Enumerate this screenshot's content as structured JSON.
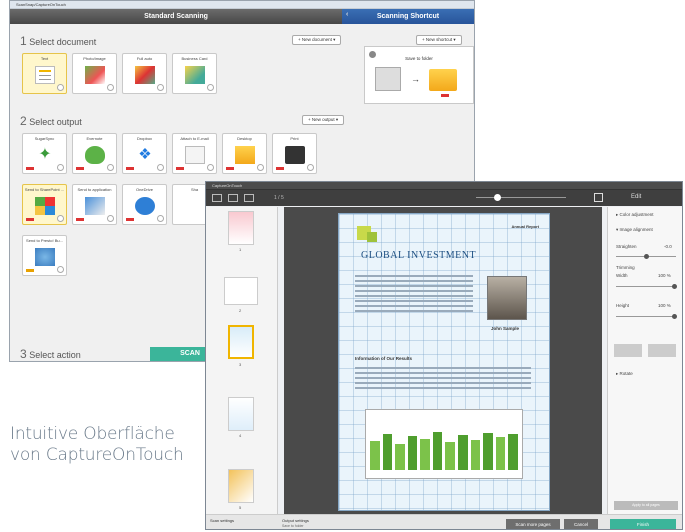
{
  "win1": {
    "title_bar": "ScanSnap/CaptureOnTouch",
    "header_left": "Standard Scanning",
    "header_right": "Scanning Shortcut",
    "section1": {
      "num": "1",
      "label": "Select document",
      "dropdown": "New document"
    },
    "section2": {
      "num": "2",
      "label": "Select output",
      "dropdown": "New output"
    },
    "section3": {
      "num": "3",
      "label": "Select action"
    },
    "shortcut_dropdown": "New shortcut",
    "shortcut_tile": "Save to folder",
    "documents": [
      "Text",
      "Photo/image",
      "Full auto",
      "Business Card"
    ],
    "outputs": [
      "SugarSync",
      "Evernote",
      "Dropbox",
      "Attach to E-mail",
      "Desktop",
      "Print"
    ],
    "outputs2": [
      "Send to SharePoint ...",
      "Send to application",
      "OneDrive",
      "Sha"
    ],
    "outputs3": [
      "Send to Presto! Bu..."
    ],
    "scan_button": "SCAN"
  },
  "win2": {
    "title_bar": "CaptureOnTouch",
    "page_indicator": "1 / 5",
    "edit_label": "Edit",
    "thumb_numbers": [
      "1",
      "2",
      "3",
      "4",
      "5"
    ],
    "panel": {
      "color_adjustment": "Color adjustment",
      "image_alignment": "Image alignment",
      "straighten": "Straighten",
      "straighten_value": "-0.0",
      "trimming": "Trimming",
      "width": "Width",
      "width_value": "100 %",
      "height": "Height",
      "height_value": "100 %",
      "rotate": "Rotate",
      "apply": "Apply to all pages"
    },
    "doc": {
      "tag": "Annual Report",
      "headline": "GLOBAL INVESTMENT",
      "person": "John Sample",
      "subhead": "Information of Our Results"
    },
    "status": {
      "scan_settings": "Scan settings",
      "output_settings": "Output settings",
      "output_value": "Save to folder",
      "scan_more": "Scan more pages",
      "cancel": "Cancel",
      "finish": "Finish"
    }
  },
  "caption": {
    "line1": "Intuitive Oberfläche",
    "line2": "von CaptureOnTouch"
  }
}
